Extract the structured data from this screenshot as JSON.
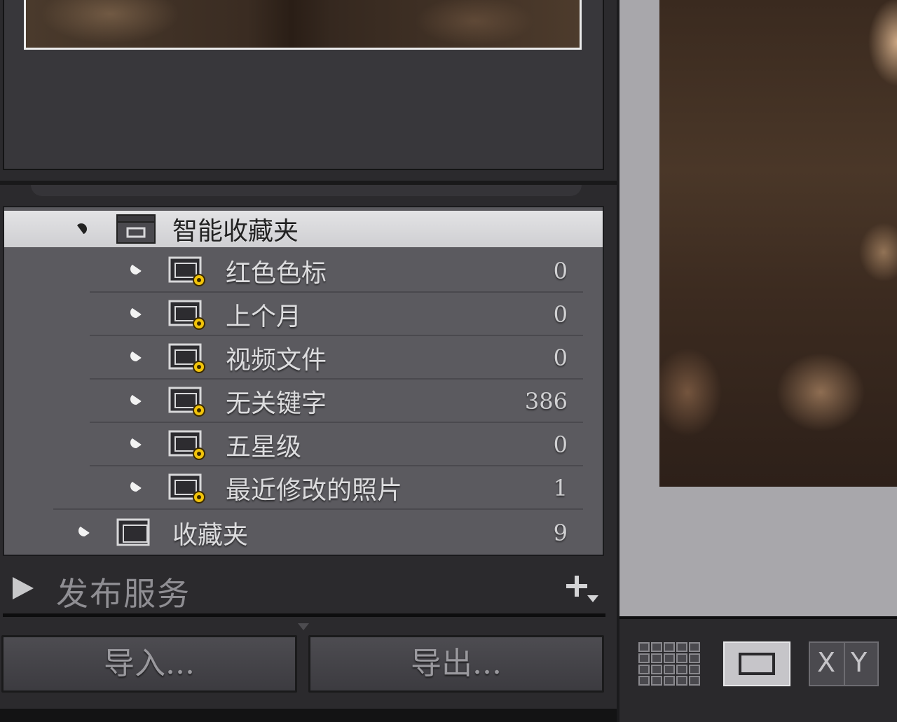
{
  "collections_panel": {
    "smart_group": {
      "label": "智能收藏夹"
    },
    "items": [
      {
        "label": "红色色标",
        "count": "0"
      },
      {
        "label": "上个月",
        "count": "0"
      },
      {
        "label": "视频文件",
        "count": "0"
      },
      {
        "label": "无关键字",
        "count": "386"
      },
      {
        "label": "五星级",
        "count": "0"
      },
      {
        "label": "最近修改的照片",
        "count": "1"
      }
    ],
    "collection_set": {
      "label": "收藏夹",
      "count": "9"
    }
  },
  "publish_services": {
    "label": "发布服务",
    "add_icon": "plus-dropdown-icon"
  },
  "buttons": {
    "import_label": "导入...",
    "export_label": "导出..."
  },
  "view_toolbar": {
    "grid_icon": "grid-view-icon",
    "loupe_icon": "loupe-view-icon",
    "compare": {
      "left": "X",
      "right": "Y"
    }
  },
  "colors": {
    "selected_row": "#dcdcde",
    "panel": "#5b5a5f",
    "badge_gear": "#f2c40a"
  }
}
